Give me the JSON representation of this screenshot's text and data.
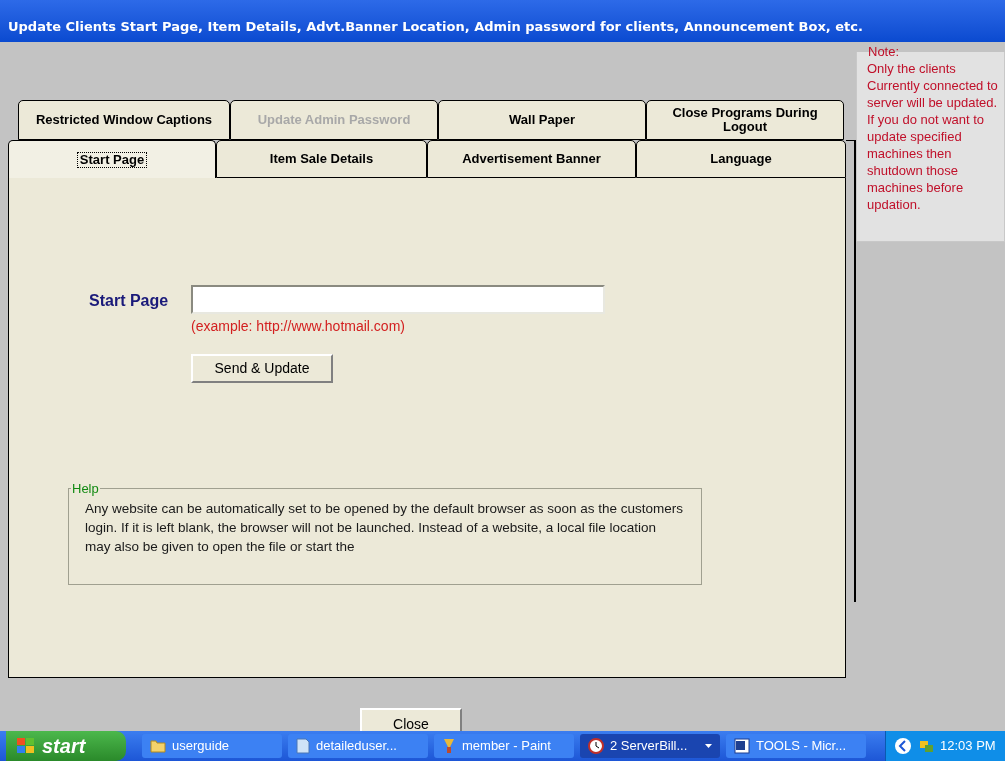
{
  "window": {
    "title": "Update Clients Start Page, Item Details, Advt.Banner Location, Admin password for clients, Announcement Box, etc."
  },
  "tab_rows": [
    [
      {
        "label": "Restricted Window Captions",
        "selected": false,
        "disabled": false
      },
      {
        "label": "Update Admin Password",
        "selected": false,
        "disabled": true
      },
      {
        "label": "Wall Paper",
        "selected": false,
        "disabled": false
      },
      {
        "label": "Close Programs During Logout",
        "selected": false,
        "disabled": false
      }
    ],
    [
      {
        "label": "Start Page",
        "selected": true,
        "disabled": false
      },
      {
        "label": "Item Sale Details",
        "selected": false,
        "disabled": false
      },
      {
        "label": "Advertisement Banner",
        "selected": false,
        "disabled": false
      },
      {
        "label": "Language",
        "selected": false,
        "disabled": false
      }
    ]
  ],
  "start_page": {
    "label": "Start Page",
    "example": "(example: http://www.hotmail.com)",
    "button": "Send & Update"
  },
  "help": {
    "title": "Help",
    "text": "Any website can be automatically set to be opened by the default browser as soon as the customers login. If it is left blank, the  browser will not be launched. Instead of a website, a local file location may also be given to open the file or start the"
  },
  "note": {
    "title": "Note:",
    "text": "Only the clients Currently connected to server will be updated. If you do not want to update specified machines then shutdown those machines before updation."
  },
  "close_button": "Close",
  "taskbar": {
    "start": "start",
    "items": [
      {
        "label": "userguide",
        "kind": "folder",
        "selected": false
      },
      {
        "label": "detaileduser...",
        "kind": "document",
        "selected": false
      },
      {
        "label": "member - Paint",
        "kind": "paint",
        "selected": false
      },
      {
        "label": "2 ServerBill...",
        "kind": "group",
        "selected": true
      },
      {
        "label": "TOOLS - Micr...",
        "kind": "word",
        "selected": false
      }
    ],
    "clock": "12:03 PM"
  }
}
